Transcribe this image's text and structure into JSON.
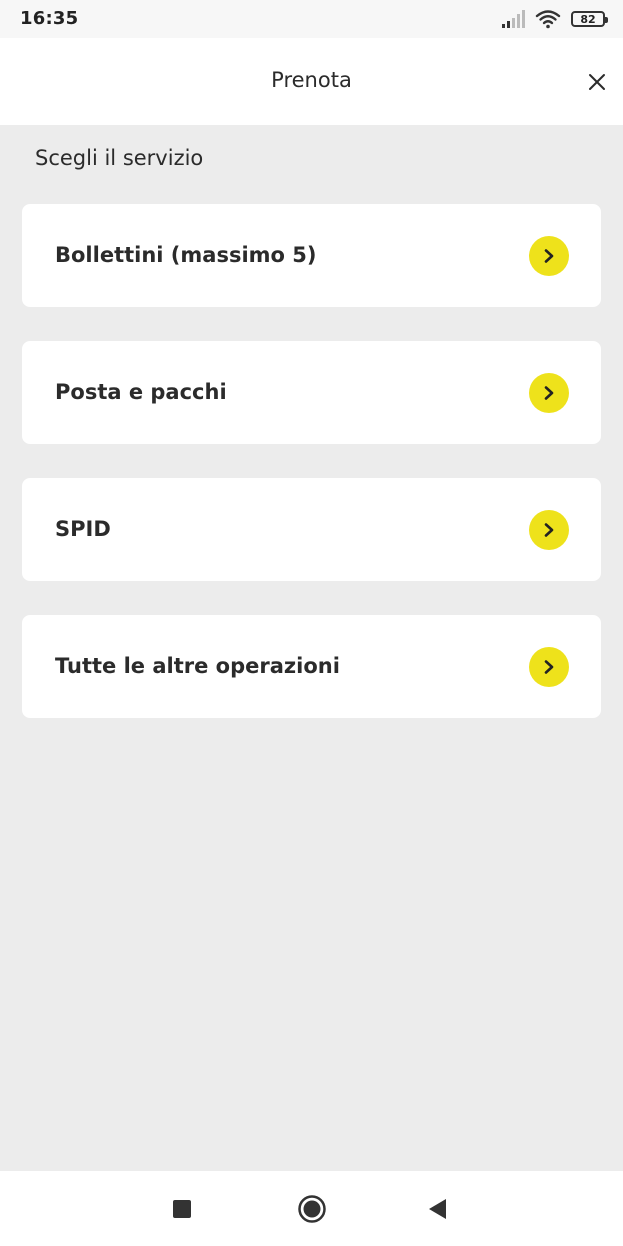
{
  "status_bar": {
    "time": "16:35",
    "battery": "82",
    "icons": [
      "signal-icon",
      "wifi-icon",
      "battery-icon"
    ]
  },
  "header": {
    "title": "Prenota",
    "close_icon": "close-icon"
  },
  "section": {
    "title": "Scegli il servizio"
  },
  "services": [
    {
      "label": "Bollettini (massimo 5)"
    },
    {
      "label": "Posta e pacchi"
    },
    {
      "label": "SPID"
    },
    {
      "label": "Tutte le altre operazioni"
    }
  ],
  "nav": {
    "icons": [
      "recents-icon",
      "home-icon",
      "back-icon"
    ]
  },
  "colors": {
    "accent": "#eee21b",
    "background": "#ececec",
    "card": "#ffffff",
    "text": "#2b2b2b"
  }
}
